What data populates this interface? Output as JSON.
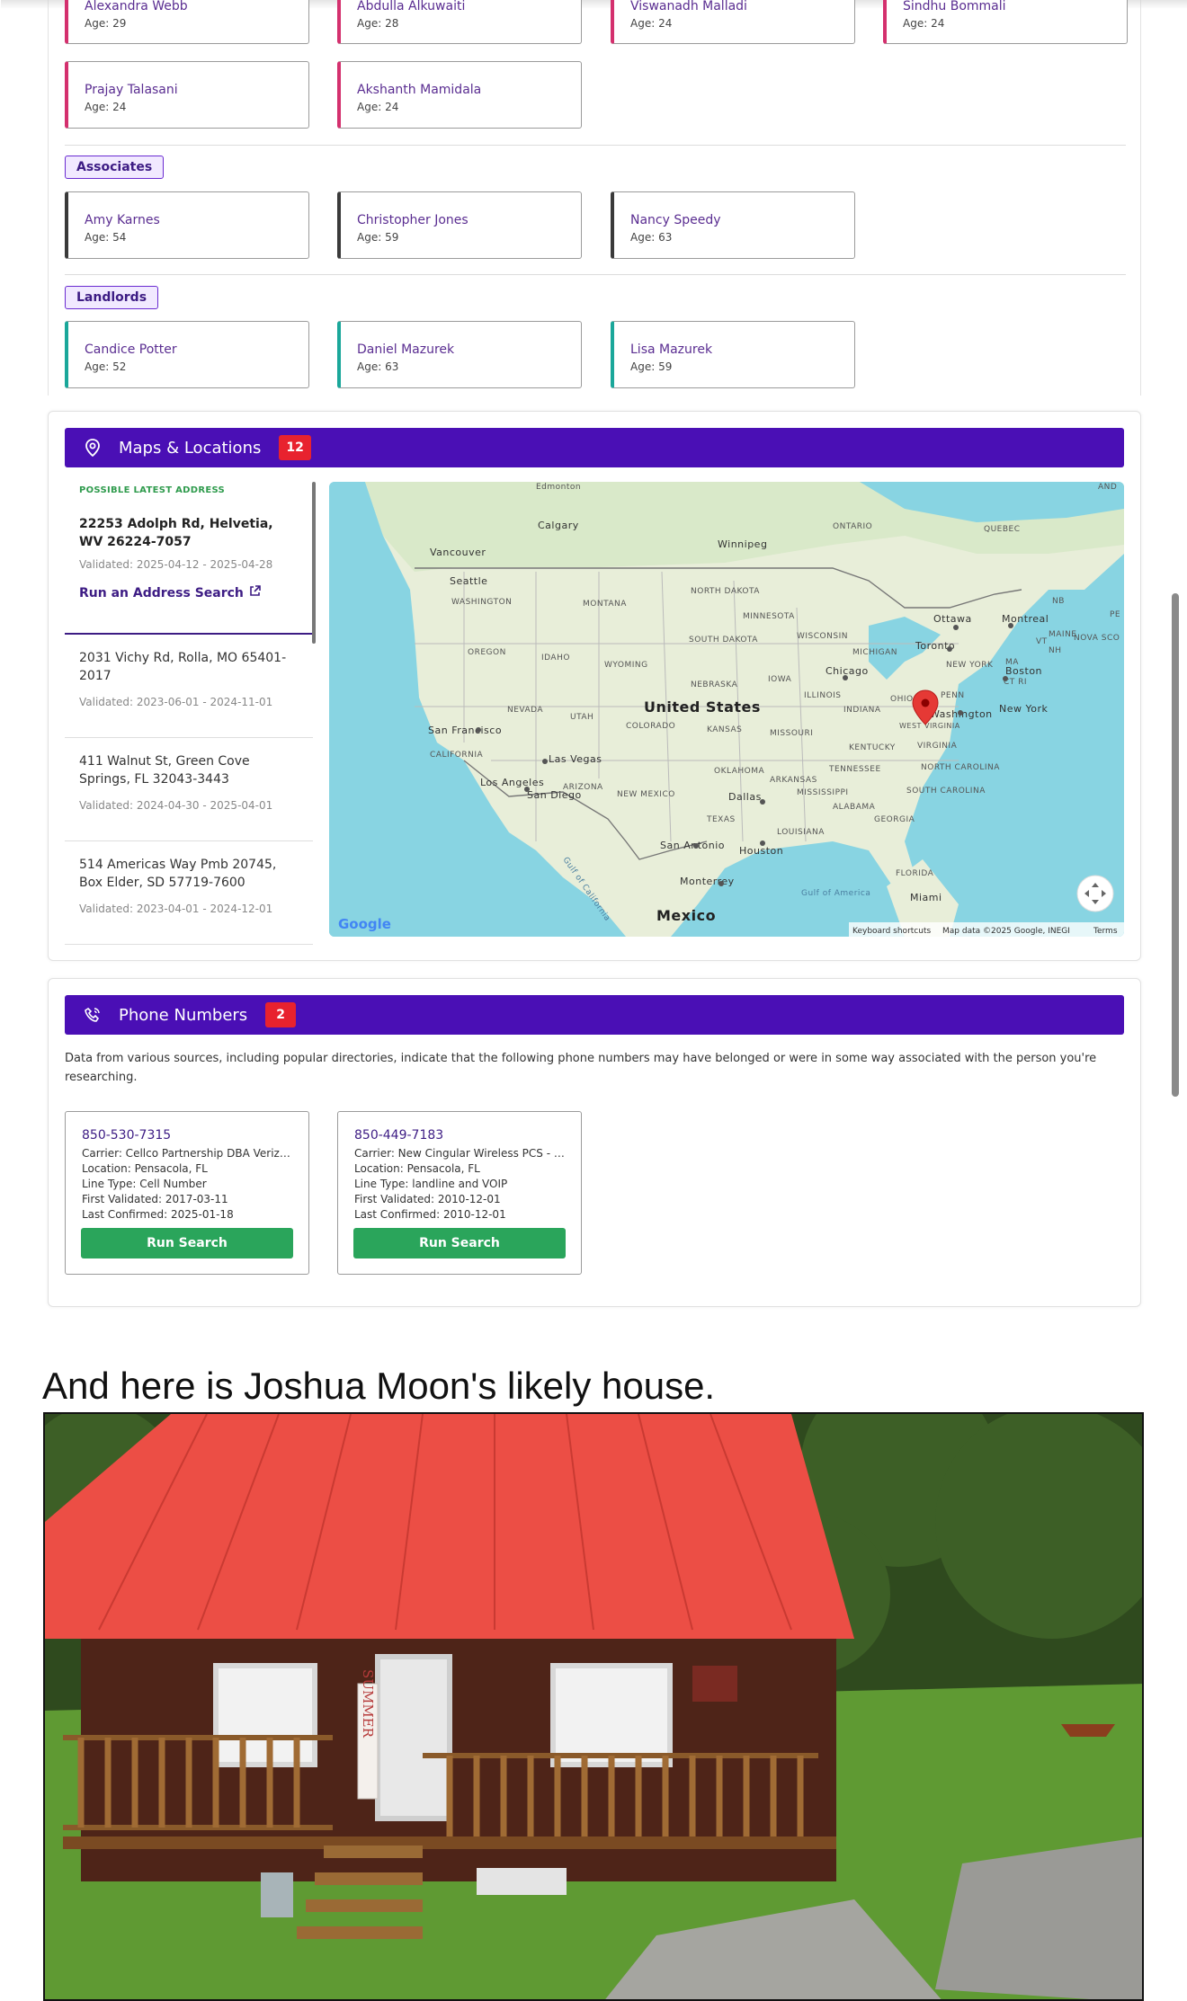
{
  "relatives_section": {
    "row1": [
      {
        "name": "Alexandra Webb",
        "age": "Age: 29"
      },
      {
        "name": "Abdulla Alkuwaiti",
        "age": "Age: 28"
      },
      {
        "name": "Viswanadh Malladi",
        "age": "Age: 24"
      },
      {
        "name": "Sindhu Bommali",
        "age": "Age: 24"
      }
    ],
    "row2": [
      {
        "name": "Prajay Talasani",
        "age": "Age: 24"
      },
      {
        "name": "Akshanth Mamidala",
        "age": "Age: 24"
      }
    ],
    "associates": {
      "label": "Associates",
      "people": [
        {
          "name": "Amy Karnes",
          "age": "Age: 54"
        },
        {
          "name": "Christopher Jones",
          "age": "Age: 59"
        },
        {
          "name": "Nancy Speedy",
          "age": "Age: 63"
        }
      ]
    },
    "landlords": {
      "label": "Landlords",
      "people": [
        {
          "name": "Candice Potter",
          "age": "Age: 52"
        },
        {
          "name": "Daniel Mazurek",
          "age": "Age: 63"
        },
        {
          "name": "Lisa Mazurek",
          "age": "Age: 59"
        }
      ]
    }
  },
  "maps": {
    "title": "Maps & Locations",
    "count": "12",
    "latest_label": "POSSIBLE LATEST ADDRESS",
    "latest_address": "22253 Adolph Rd, Helvetia, WV 26224-7057",
    "latest_validated": "Validated: 2025-04-12 - 2025-04-28",
    "run_address_search": "Run an Address Search",
    "addresses": [
      {
        "address": "2031 Vichy Rd, Rolla, MO 65401-2017",
        "validated": "Validated: 2023-06-01 - 2024-11-01"
      },
      {
        "address": "411 Walnut St, Green Cove Springs, FL 32043-3443",
        "validated": "Validated: 2024-04-30 - 2025-04-01"
      },
      {
        "address": "514 Americas Way Pmb 20745, Box Elder, SD 57719-7600",
        "validated": "Validated: 2023-04-01 - 2024-12-01"
      }
    ],
    "map_labels": {
      "edmonton": "Edmonton",
      "calgary": "Calgary",
      "winnipeg": "Winnipeg",
      "ontario": "ONTARIO",
      "quebec": "QUEBEC",
      "vancouver": "Vancouver",
      "seattle": "Seattle",
      "washington_state": "WASHINGTON",
      "montana": "MONTANA",
      "north_dakota": "NORTH DAKOTA",
      "minnesota": "MINNESOTA",
      "oregon": "OREGON",
      "idaho": "IDAHO",
      "wyoming": "WYOMING",
      "south_dakota": "SOUTH DAKOTA",
      "wisconsin": "WISCONSIN",
      "michigan": "MICHIGAN",
      "ottawa": "Ottawa",
      "montreal": "Montreal",
      "maine": "MAINE",
      "toronto": "Toronto",
      "nova_scotia": "NOVA SCO",
      "new_york_state": "NEW YORK",
      "nebraska": "NEBRASKA",
      "iowa": "IOWA",
      "chicago": "Chicago",
      "nevada": "NEVADA",
      "utah": "UTAH",
      "united_states": "United States",
      "colorado": "COLORADO",
      "illinois": "ILLINOIS",
      "ohio": "OHIO",
      "penn": "PENN",
      "indiana": "INDIANA",
      "boston": "Boston",
      "san_francisco": "San Francisco",
      "kansas": "KANSAS",
      "missouri": "MISSOURI",
      "new_york_city": "New York",
      "washington_dc": "Washington",
      "west_virginia": "WEST VIRGINIA",
      "virginia": "VIRGINIA",
      "california": "CALIFORNIA",
      "las_vegas": "Las Vegas",
      "kentucky": "KENTUCKY",
      "oklahoma": "OKLAHOMA",
      "los_angeles": "Los Angeles",
      "arizona": "ARIZONA",
      "tennessee": "TENNESSEE",
      "north_carolina": "NORTH CAROLINA",
      "san_diego": "San Diego",
      "new_mexico": "NEW MEXICO",
      "arkansas": "ARKANSAS",
      "dallas": "Dallas",
      "mississippi": "MISSISSIPPI",
      "south_carolina": "SOUTH CAROLINA",
      "alabama": "ALABAMA",
      "texas": "TEXAS",
      "georgia": "GEORGIA",
      "louisiana": "LOUISIANA",
      "san_antonio": "San Antonio",
      "houston": "Houston",
      "gulf_california": "Gulf of California",
      "florida": "FLORIDA",
      "monterrey": "Monterrey",
      "gulf_america": "Gulf of America",
      "miami": "Miami",
      "mexico": "Mexico",
      "google": "Google",
      "keyboard": "Keyboard shortcuts",
      "map_data": "Map data ©2025 Google, INEGI",
      "terms": "Terms",
      "and": "AND",
      "nb": "NB",
      "vt": "VT",
      "nh": "NH",
      "ma": "MA",
      "ct_ri": "CT RI",
      "pe": "PE"
    }
  },
  "phones": {
    "title": "Phone Numbers",
    "count": "2",
    "intro": "Data from various sources, including popular directories, indicate that the following phone numbers may have belonged or were in some way associated with the person you're researching.",
    "items": [
      {
        "number": "850-530-7315",
        "carrier": "Carrier: Cellco Partnership DBA Verizon Wireless",
        "location": "Location: Pensacola, FL",
        "line": "Line Type: Cell Number",
        "first": "First Validated: 2017-03-11",
        "last": "Last Confirmed: 2025-01-18",
        "button": "Run Search"
      },
      {
        "number": "850-449-7183",
        "carrier": "Carrier: New Cingular Wireless PCS - GA",
        "location": "Location: Pensacola, FL",
        "line": "Line Type: landline and VOIP",
        "first": "First Validated: 2010-12-01",
        "last": "Last Confirmed: 2010-12-01",
        "button": "Run Search"
      }
    ]
  },
  "house_caption": "And here is Joshua Moon's likely house.",
  "house_sign": "SUMMER",
  "colors": {
    "header": "#4a0fb5",
    "badge": "#e8222e",
    "relative_border": "#d4306e",
    "associate_border": "#3a3a3a",
    "landlord_border": "#1aa79a",
    "button": "#2aa55b",
    "roof": "#ec4e45"
  }
}
